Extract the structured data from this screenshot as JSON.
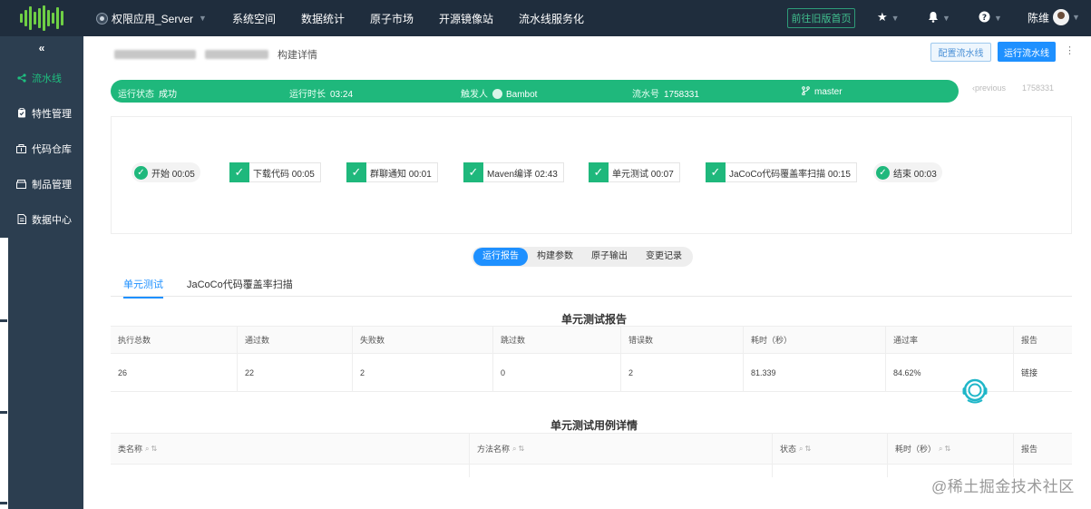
{
  "topbar": {
    "project": "权限应用_Server",
    "nav": [
      "系统空间",
      "数据统计",
      "原子市场",
      "开源镜像站",
      "流水线服务化"
    ],
    "old_version": "前往旧版首页",
    "user_name": "陈维",
    "icons": [
      "star-icon",
      "bell-icon",
      "help-icon"
    ]
  },
  "sidebar": {
    "collapse": "«",
    "items": [
      {
        "label": "流水线",
        "icon": "share-icon",
        "active": true
      },
      {
        "label": "特性管理",
        "icon": "clipboard-icon"
      },
      {
        "label": "代码仓库",
        "icon": "repository-icon"
      },
      {
        "label": "制品管理",
        "icon": "package-icon"
      },
      {
        "label": "数据中心",
        "icon": "data-icon"
      }
    ]
  },
  "header": {
    "page_title": "构建详情",
    "config_button": "配置流水线",
    "run_button": "运行流水线",
    "more": "⋮"
  },
  "status": {
    "state_label": "运行状态",
    "state_value": "成功",
    "duration_label": "运行时长",
    "duration_value": "03:24",
    "trigger_label": "触发人",
    "trigger_value": "Bambot",
    "number_label": "流水号",
    "number_value": "1758331",
    "branch": "master"
  },
  "pager": {
    "prev": "‹previous",
    "current": "1758331"
  },
  "stages": [
    {
      "name": "开始 00:05",
      "style": "round"
    },
    {
      "name": "下载代码 00:05",
      "style": "box"
    },
    {
      "name": "群聊通知 00:01",
      "style": "box"
    },
    {
      "name": "Maven编译 02:43",
      "style": "box"
    },
    {
      "name": "单元测试 00:07",
      "style": "box"
    },
    {
      "name": "JaCoCo代码覆盖率扫描 00:15",
      "style": "box"
    },
    {
      "name": "结束 00:03",
      "style": "round"
    }
  ],
  "tabs": [
    "运行报告",
    "构建参数",
    "原子输出",
    "变更记录"
  ],
  "subtabs": [
    "单元测试",
    "JaCoCo代码覆盖率扫描"
  ],
  "report": {
    "title": "单元测试报告",
    "headers": [
      "执行总数",
      "通过数",
      "失败数",
      "跳过数",
      "错误数",
      "耗时（秒）",
      "通过率",
      "报告"
    ],
    "row": [
      "26",
      "22",
      "2",
      "0",
      "2",
      "81.339",
      "84.62%",
      "链接"
    ]
  },
  "cases": {
    "title": "单元测试用例详情",
    "headers": [
      "类名称",
      "方法名称",
      "状态",
      "耗时（秒）",
      "报告"
    ]
  },
  "watermark": "@稀土掘金技术社区",
  "colors": {
    "topbar": "#1f2d3d",
    "sidebar": "#2c3e50",
    "success": "#1fb87c",
    "primary": "#1e90ff"
  }
}
